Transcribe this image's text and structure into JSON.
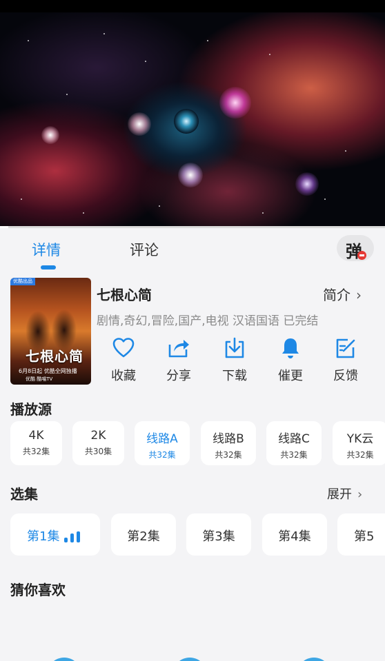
{
  "tabs": [
    {
      "label": "详情",
      "active": true
    },
    {
      "label": "评论",
      "active": false
    }
  ],
  "danmaku": {
    "label": "弹"
  },
  "poster": {
    "tag": "优酷出品",
    "title": "七根心简",
    "date_text": "6月8日起 优酷全网独播",
    "logos": "优酷 酷喵TV"
  },
  "detail": {
    "title": "七根心简",
    "intro_link": "简介",
    "meta": "剧情,奇幻,冒险,国产,电视 汉语国语 已完结"
  },
  "actions": [
    {
      "label": "收藏",
      "icon": "heart-icon"
    },
    {
      "label": "分享",
      "icon": "share-icon"
    },
    {
      "label": "下载",
      "icon": "download-icon"
    },
    {
      "label": "催更",
      "icon": "bell-icon"
    },
    {
      "label": "反馈",
      "icon": "edit-icon"
    }
  ],
  "sources_title": "播放源",
  "sources": [
    {
      "name": "4K",
      "count": "共32集",
      "active": false
    },
    {
      "name": "2K",
      "count": "共30集",
      "active": false
    },
    {
      "name": "线路A",
      "count": "共32集",
      "active": true
    },
    {
      "name": "线路B",
      "count": "共32集",
      "active": false
    },
    {
      "name": "线路C",
      "count": "共32集",
      "active": false
    },
    {
      "name": "YK云",
      "count": "共32集",
      "active": false
    }
  ],
  "episodes_title": "选集",
  "expand_label": "展开",
  "episodes": [
    {
      "label": "第1集",
      "active": true
    },
    {
      "label": "第2集",
      "active": false
    },
    {
      "label": "第3集",
      "active": false
    },
    {
      "label": "第4集",
      "active": false
    },
    {
      "label": "第5",
      "active": false
    }
  ],
  "recommend_title": "猜你喜欢",
  "colors": {
    "accent": "#1e88e5",
    "danmaku_off": "#e53935"
  }
}
